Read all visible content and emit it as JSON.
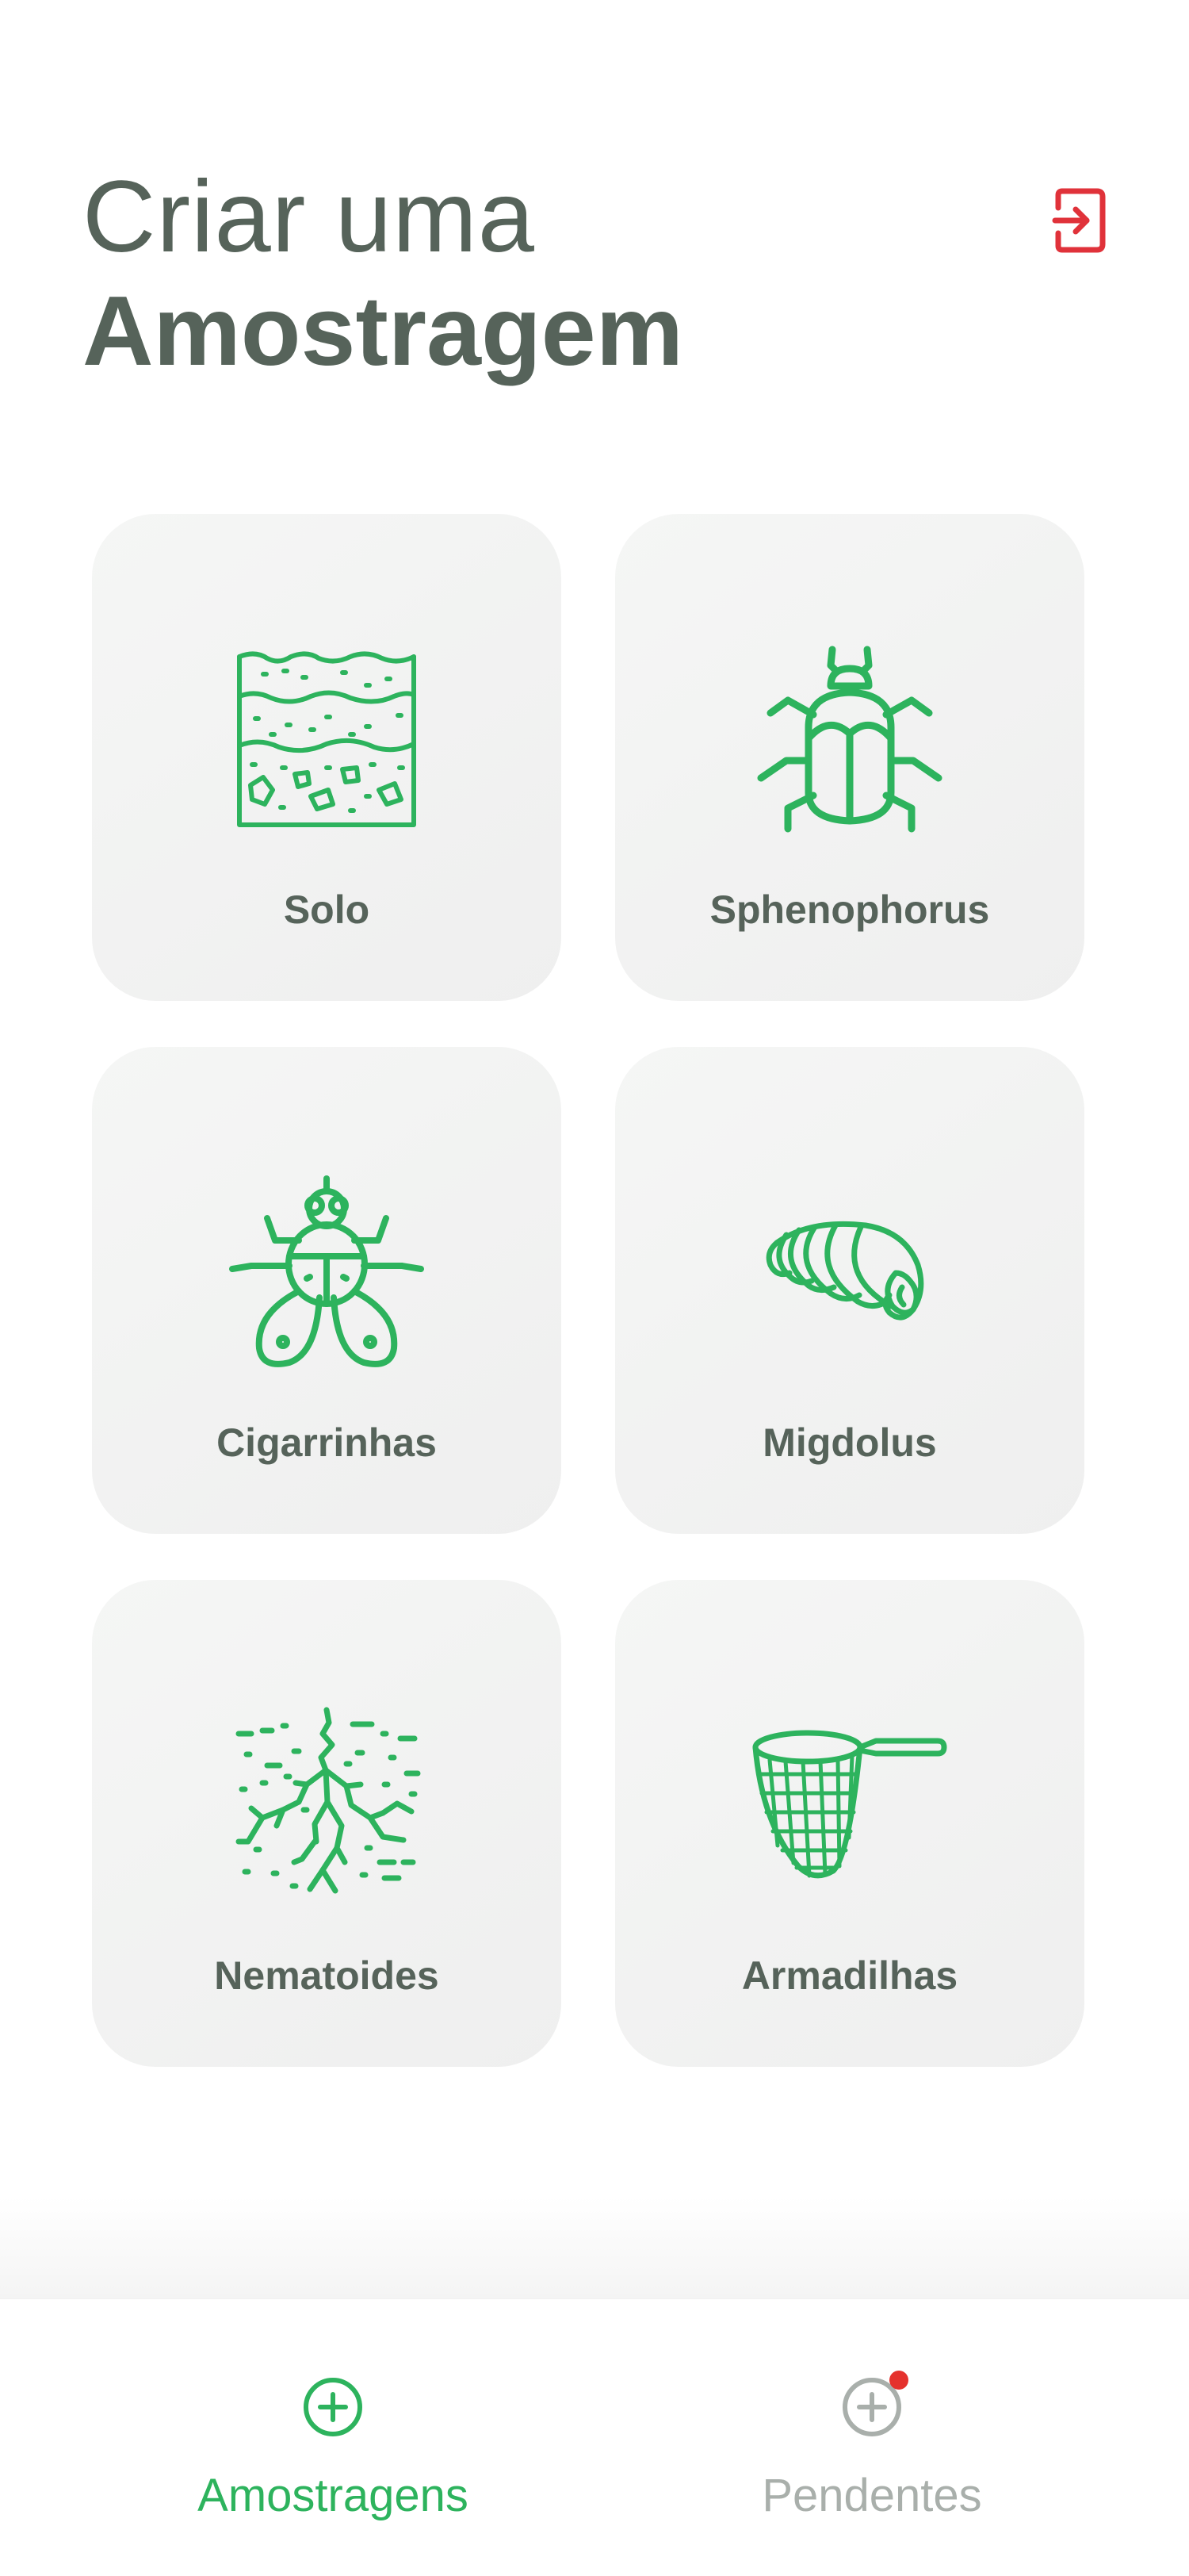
{
  "header": {
    "title_line1": "Criar uma",
    "title_line2": "Amostragem",
    "logout_icon": "logout-icon"
  },
  "options": [
    {
      "label": "Solo",
      "icon": "soil-layers-icon"
    },
    {
      "label": "Sphenophorus",
      "icon": "beetle-icon"
    },
    {
      "label": "Cigarrinhas",
      "icon": "fly-icon"
    },
    {
      "label": "Migdolus",
      "icon": "larva-icon"
    },
    {
      "label": "Nematoides",
      "icon": "roots-icon"
    },
    {
      "label": "Armadilhas",
      "icon": "net-icon"
    }
  ],
  "bottom_nav": {
    "items": [
      {
        "label": "Amostragens",
        "icon": "plus-circle-icon",
        "active": true
      },
      {
        "label": "Pendentes",
        "icon": "plus-circle-icon",
        "active": false,
        "has_notification": true
      }
    ]
  },
  "colors": {
    "accent_green": "#2db35d",
    "text_gray": "#56635a",
    "logout_red": "#e0323a",
    "notification_red": "#e5322d",
    "inactive_gray": "#a9afab"
  }
}
